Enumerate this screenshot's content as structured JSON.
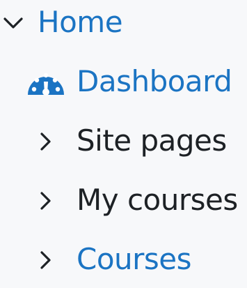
{
  "nav": {
    "home": {
      "label": "Home",
      "icon": "chevron-down-icon",
      "expanded": true
    },
    "dashboard": {
      "label": "Dashboard",
      "icon": "dashboard-gauge-icon"
    },
    "site_pages": {
      "label": "Site pages",
      "icon": "chevron-right-icon",
      "expanded": false
    },
    "my_courses": {
      "label": "My courses",
      "icon": "chevron-right-icon",
      "expanded": false
    },
    "courses": {
      "label": "Courses",
      "icon": "chevron-right-icon",
      "expanded": false
    }
  },
  "colors": {
    "link": "#1b74c3",
    "text": "#1d2125",
    "background": "#f7f8fa"
  }
}
